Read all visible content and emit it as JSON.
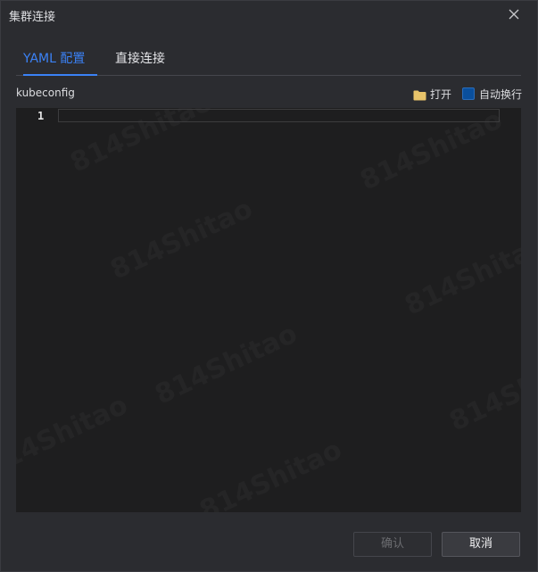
{
  "dialog": {
    "title": "集群连接"
  },
  "tabs": [
    {
      "label": "YAML 配置",
      "active": true
    },
    {
      "label": "直接连接",
      "active": false
    }
  ],
  "toolbar": {
    "kubeconfig_label": "kubeconfig",
    "open_label": "打开",
    "wrap_label": "自动换行",
    "wrap_checked": true
  },
  "editor": {
    "line_numbers": [
      "1"
    ],
    "content": ""
  },
  "footer": {
    "confirm_label": "确认",
    "cancel_label": "取消"
  },
  "colors": {
    "accent": "#3b82f6",
    "background": "#2b2c30",
    "editor_background": "#1e1e1f",
    "folder_icon": "#e8c46a",
    "checkbox": "#0a4f9c"
  },
  "watermark": "814Shitao"
}
